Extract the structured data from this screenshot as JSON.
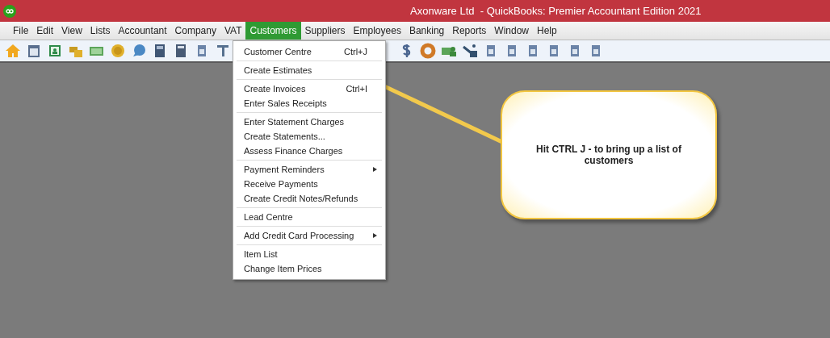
{
  "window": {
    "title": "Axonware Ltd  - QuickBooks: Premier Accountant Edition 2021"
  },
  "menu_bar": [
    {
      "label": "File",
      "selected": false
    },
    {
      "label": "Edit",
      "selected": false
    },
    {
      "label": "View",
      "selected": false
    },
    {
      "label": "Lists",
      "selected": false
    },
    {
      "label": "Accountant",
      "selected": false
    },
    {
      "label": "Company",
      "selected": false
    },
    {
      "label": "VAT",
      "selected": false
    },
    {
      "label": "Customers",
      "selected": true
    },
    {
      "label": "Suppliers",
      "selected": false
    },
    {
      "label": "Employees",
      "selected": false
    },
    {
      "label": "Banking",
      "selected": false
    },
    {
      "label": "Reports",
      "selected": false
    },
    {
      "label": "Window",
      "selected": false
    },
    {
      "label": "Help",
      "selected": false
    }
  ],
  "dropdown": {
    "groups": [
      [
        {
          "label": "Customer Centre",
          "shortcut": "Ctrl+J",
          "submenu": false
        }
      ],
      [
        {
          "label": "Create Estimates",
          "submenu": false
        }
      ],
      [
        {
          "label": "Create Invoices",
          "shortcut": "Ctrl+I",
          "submenu": false
        },
        {
          "label": "Enter Sales Receipts",
          "submenu": false
        }
      ],
      [
        {
          "label": "Enter Statement Charges",
          "submenu": false
        },
        {
          "label": "Create Statements...",
          "submenu": false
        },
        {
          "label": "Assess Finance Charges",
          "submenu": false
        }
      ],
      [
        {
          "label": "Payment Reminders",
          "submenu": true
        },
        {
          "label": "Receive Payments",
          "submenu": false
        },
        {
          "label": "Create Credit Notes/Refunds",
          "submenu": false
        }
      ],
      [
        {
          "label": "Lead Centre",
          "submenu": false
        }
      ],
      [
        {
          "label": "Add Credit Card Processing",
          "submenu": true
        }
      ],
      [
        {
          "label": "Item List",
          "submenu": false
        },
        {
          "label": "Change Item Prices",
          "submenu": false
        }
      ]
    ]
  },
  "callout": {
    "text": "Hit CTRL J - to bring up a list of customers"
  }
}
